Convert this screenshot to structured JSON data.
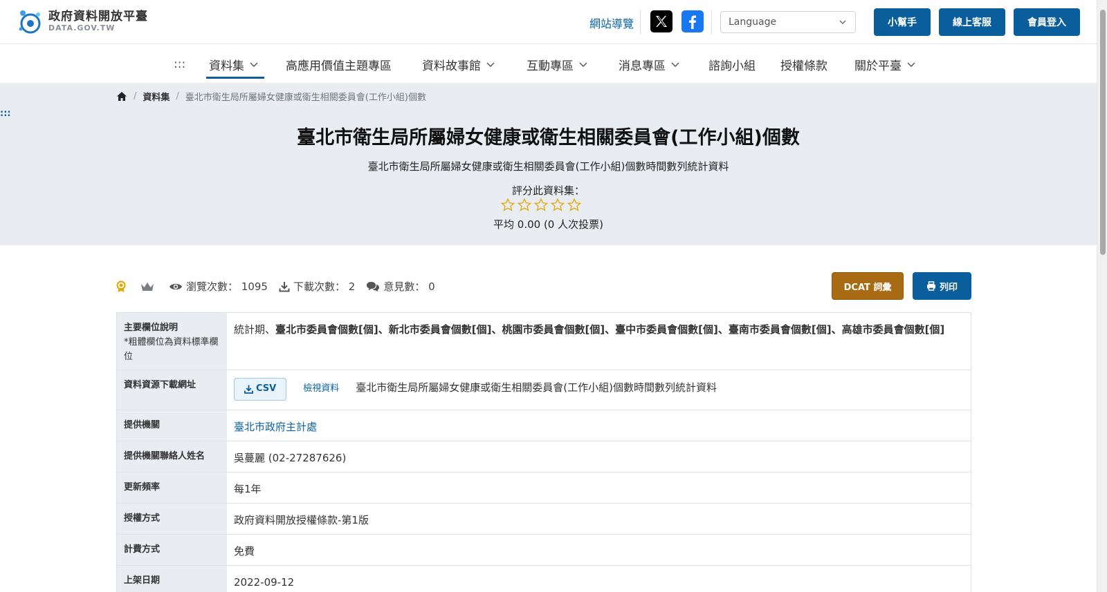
{
  "header": {
    "logo_zh": "政府資料開放平臺",
    "logo_en": "DATA.GOV.TW",
    "sitemap": "網站導覽",
    "language_placeholder": "Language",
    "helper": "小幫手",
    "support": "線上客服",
    "login": "會員登入"
  },
  "nav": {
    "accesskey": ":::",
    "items": [
      {
        "label": "資料集"
      },
      {
        "label": "高應用價值主題專區"
      },
      {
        "label": "資料故事館"
      },
      {
        "label": "互動專區"
      },
      {
        "label": "消息專區"
      },
      {
        "label": "諮詢小組"
      },
      {
        "label": "授權條款"
      },
      {
        "label": "關於平臺"
      }
    ]
  },
  "breadcrumb": {
    "level1": "資料集",
    "current": "臺北市衛生局所屬婦女健康或衛生相關委員會(工作小組)個數"
  },
  "hero": {
    "skip": ":::",
    "title": "臺北市衛生局所屬婦女健康或衛生相關委員會(工作小組)個數",
    "subtitle": "臺北市衛生局所屬婦女健康或衛生相關委員會(工作小組)個數時間數列統計資料",
    "rate_label": "評分此資料集：",
    "rating_value": 0,
    "average": "平均 0.00 (0 人次投票)"
  },
  "stats": {
    "views_label": "瀏覽次數：",
    "views": "1095",
    "downloads_label": "下載次數：",
    "downloads": "2",
    "comments_label": "意見數：",
    "comments": "0"
  },
  "actions": {
    "dcat": "DCAT 詞彙",
    "print": "列印"
  },
  "table": {
    "fields_label": "主要欄位說明",
    "fields_note": "*粗體欄位為資料標準欄位",
    "fields_plain": "統計期、",
    "fields_bold": "臺北市委員會個數[個]、新北市委員會個數[個]、桃園市委員會個數[個]、臺中市委員會個數[個]、臺南市委員會個數[個]、高雄市委員會個數[個]",
    "download_label": "資料資源下載網址",
    "csv": "CSV",
    "view": "檢視資料",
    "resource_desc": "臺北市衛生局所屬婦女健康或衛生相關委員會(工作小組)個數時間數列統計資料",
    "provider_label": "提供機關",
    "provider": "臺北市政府主計處",
    "contact_label": "提供機關聯絡人姓名",
    "contact": "吳蔓麗 (02-27287626)",
    "freq_label": "更新頻率",
    "freq": "每1年",
    "license_label": "授權方式",
    "license": "政府資料開放授權條款-第1版",
    "fee_label": "計費方式",
    "fee": "免費",
    "date_label": "上架日期",
    "date": "2022-09-12"
  },
  "colors": {
    "primary": "#0a5e9b",
    "dcat": "#a86a12",
    "hero_bg": "#e9edf1",
    "star": "#e0a800"
  }
}
